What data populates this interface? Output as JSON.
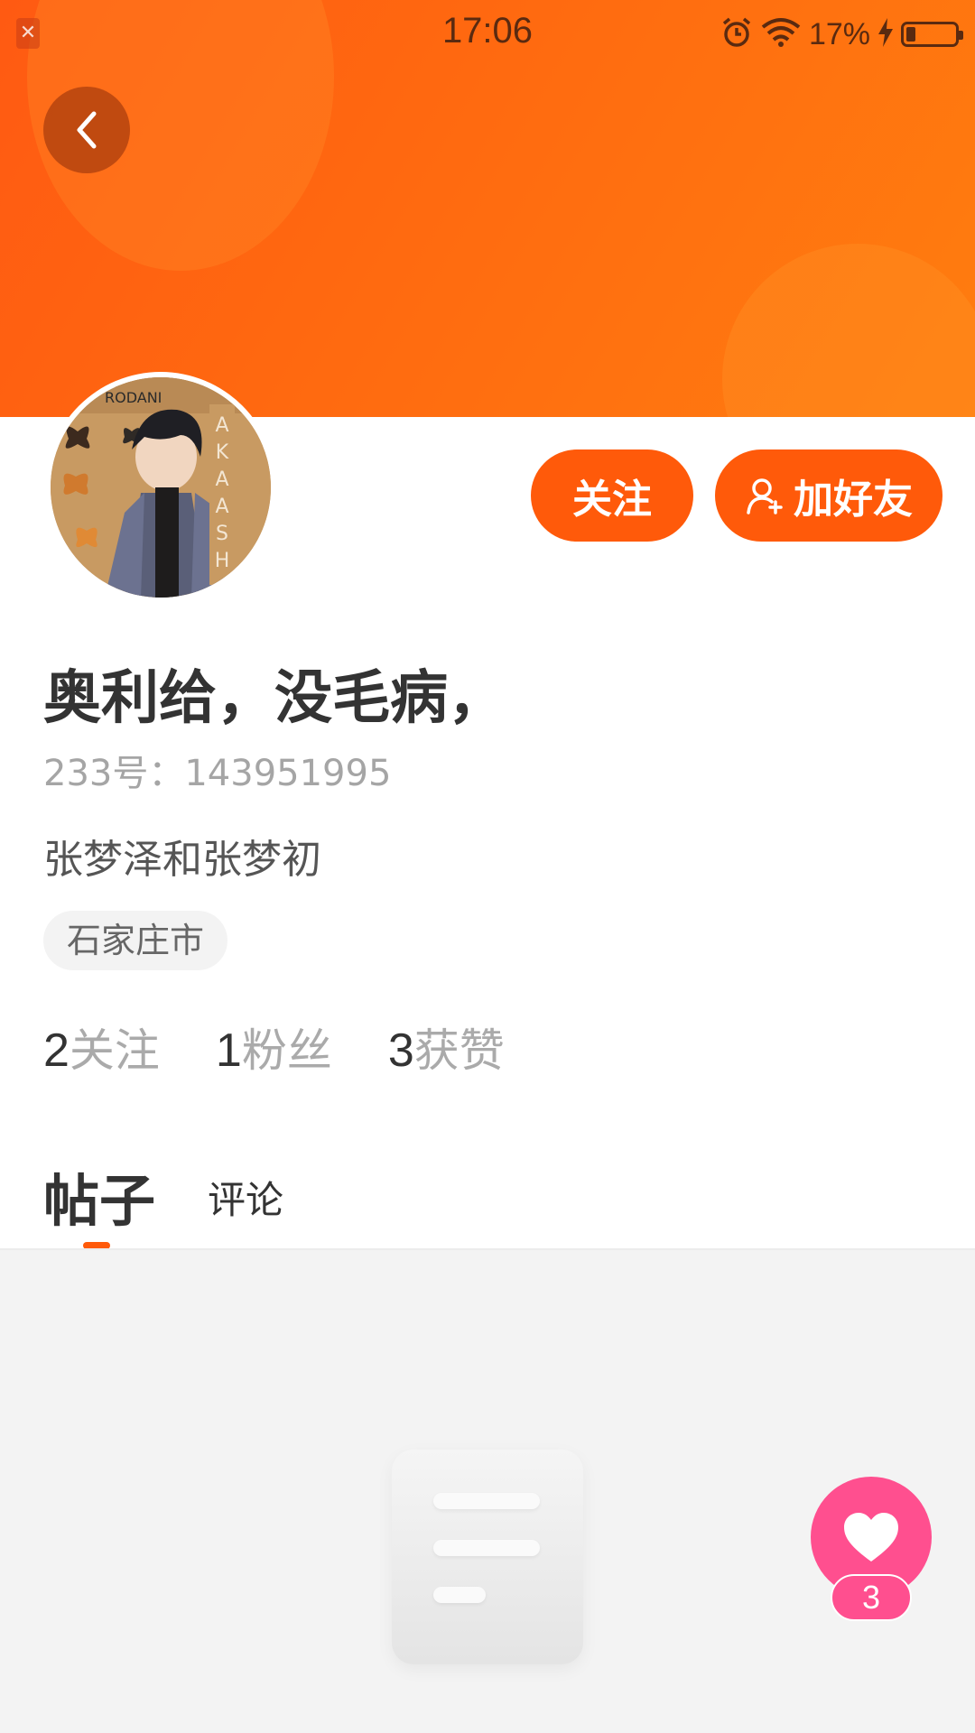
{
  "status_bar": {
    "time": "17:06",
    "battery_percent": "17%",
    "battery_level": 0.17,
    "icons": [
      "notification-icon",
      "alarm-icon",
      "wifi-icon",
      "charging-icon",
      "battery-icon"
    ]
  },
  "header": {
    "back_icon": "chevron-left-icon",
    "banner_color": "#ff6a10"
  },
  "profile": {
    "nickname": "奥利给，没毛病，",
    "user_id": "233号：143951995",
    "bio": "张梦泽和张梦初",
    "location": "石家庄市",
    "follow_label": "关注",
    "add_friend_label": "加好友",
    "accent_color": "#ff5a0a"
  },
  "stats": [
    {
      "value": "2",
      "label": "关注"
    },
    {
      "value": "1",
      "label": "粉丝"
    },
    {
      "value": "3",
      "label": "获赞"
    }
  ],
  "tabs": {
    "posts": "帖子",
    "comments": "评论",
    "active": "posts"
  },
  "like_fab": {
    "icon": "heart-icon",
    "count": "3",
    "color": "#ff4f8f"
  }
}
